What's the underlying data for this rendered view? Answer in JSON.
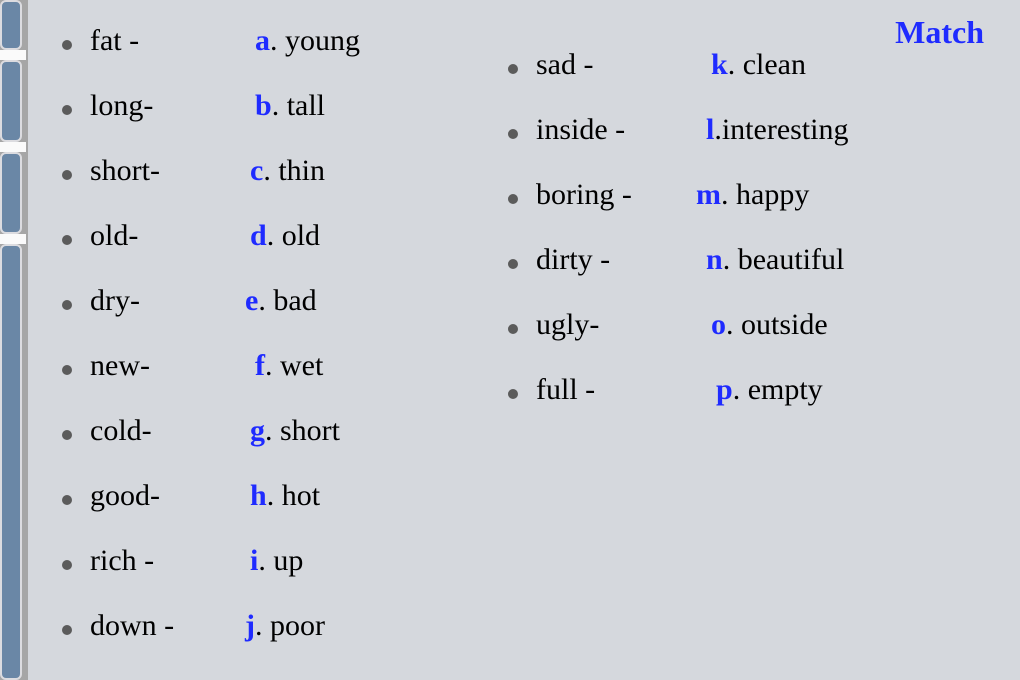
{
  "title": "Match",
  "colors": {
    "accent": "#1f2bff",
    "slide_bg": "#d5d8dd"
  },
  "left": [
    {
      "word": "fat - ",
      "word_w": 165,
      "letter": "a",
      "answer": ". young"
    },
    {
      "word": "long-",
      "word_w": 165,
      "letter": "b",
      "answer": ". tall"
    },
    {
      "word": "short-",
      "word_w": 160,
      "letter": "c",
      "answer": ". thin"
    },
    {
      "word": "old-",
      "word_w": 160,
      "letter": "d",
      "answer": ". old"
    },
    {
      "word": "dry-",
      "word_w": 155,
      "letter": "e",
      "answer": ". bad"
    },
    {
      "word": "new-",
      "word_w": 165,
      "letter": "f",
      "answer": ". wet"
    },
    {
      "word": "cold-",
      "word_w": 160,
      "letter": "g",
      "answer": ". short"
    },
    {
      "word": "good-",
      "word_w": 160,
      "letter": "h",
      "answer": ". hot"
    },
    {
      "word": "rich -",
      "word_w": 160,
      "letter": "i",
      "answer": ". up"
    },
    {
      "word": "down - ",
      "word_w": 155,
      "letter": "j",
      "answer": ". poor"
    }
  ],
  "right": [
    {
      "word": "sad -",
      "word_w": 175,
      "letter": "k",
      "answer": ". clean"
    },
    {
      "word": "inside -",
      "word_w": 170,
      "letter": "l",
      "answer": ".interesting"
    },
    {
      "word": "boring -",
      "word_w": 160,
      "letter": "m",
      "answer": ". happy"
    },
    {
      "word": "dirty -",
      "word_w": 170,
      "letter": "n",
      "answer": ". beautiful"
    },
    {
      "word": "ugly-",
      "word_w": 175,
      "letter": "o",
      "answer": ". outside"
    },
    {
      "word": "full -",
      "word_w": 180,
      "letter": "p",
      "answer": ". empty"
    }
  ]
}
